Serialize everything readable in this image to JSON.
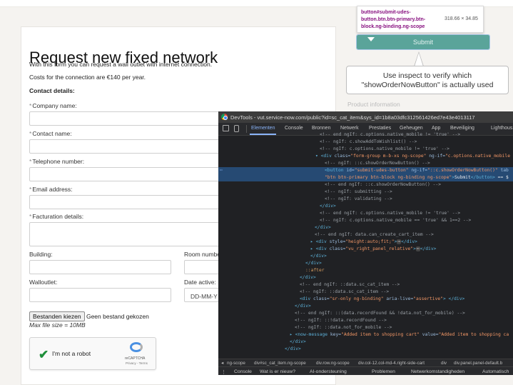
{
  "form": {
    "title": "Request new fixed network",
    "intro": "With this form you can request a wall outlet with internet connection.",
    "costs": "Costs for the connection are €140 per year.",
    "section": "Contact details:",
    "required_mark": "*",
    "fields": {
      "company": "Company name:",
      "contact": "Contact name:",
      "telephone": "Telephone number:",
      "email": "Email address:",
      "facturation": "Facturation details:",
      "building": "Building:",
      "room": "Room numbe",
      "walloutlet": "Walloutlet:",
      "date_active": "Date active:"
    },
    "date_placeholder": "DD-MM-Y",
    "file_button": "Bestanden kiezen",
    "file_status": "Geen bestand gekozen",
    "max_file_size": "Max file size = 10MB",
    "captcha": {
      "label": "I'm not a robot",
      "brand": "reCAPTCHA",
      "terms": "Privacy - Terms"
    }
  },
  "right_panel": {
    "submit_label": "Submit",
    "inspect_tooltip": {
      "selector": "button#submit-udes-button.btn.btn-primary.btn-block.ng-binding.ng-scope",
      "size": "318.66 × 34.85"
    },
    "callout": "Use inspect to verify which \"showOrderNowButton\" is actually used",
    "behind_text": "Product information"
  },
  "devtools": {
    "title": "DevTools - vut.service-now.com/public?id=sc_cat_item&sys_id=1b8a03dfc312561426ed7e43e4013117",
    "tabs": [
      "Elementen",
      "Console",
      "Bronnen",
      "Netwerk",
      "Prestaties",
      "Geheugen",
      "App",
      "Beveiliging",
      "Lighthous"
    ],
    "active_tab": "Elementen",
    "code": {
      "l0": "<!-- end ngIf: c.options.native_mobile != 'true' -->",
      "l1": "<!-- ngIf: c.showAddToWishlist() -->",
      "l2": "<!-- ngIf: c.options.native_mobile != 'true' -->",
      "l3_tag": "<div ",
      "l3_attr1": "class=",
      "l3_val1": "\"form-group m-b-xs ng-scope\"",
      "l3_attr2": " ng-if=",
      "l3_val2": "\"c.options.native_mobile",
      "l4": "<!-- ngIf: ::c.showOrderNowButton() -->",
      "l5_tag": "<button ",
      "l5_attr1": "id=",
      "l5_val1": "\"submit-udes-button\"",
      "l5_attr2": " ng-if=",
      "l5_val2": "\"::c.showOrderNowButton()\"",
      "l5_rest": " tab",
      "l6_val": "\"btn btn-primary btn-block ng-binding ng-scope\"",
      "l6_text": "Submit",
      "l6_close": "</button>",
      "l6_eq": " == $",
      "l7": "<!-- end ngIf: ::c.showOrderNowButton() -->",
      "l8": "<!-- ngIf: submitting -->",
      "l9": "<!-- ngIf: validating -->",
      "l10": "</div>",
      "l11": "<!-- end ngIf: c.options.native_mobile != 'true' -->",
      "l12": "<!-- ngIf: c.options.native_mobile == 'true' && 1==2 -->",
      "l13": "</div>",
      "l14": "<!-- end ngIf: data.can_create_cart_item -->",
      "l15_tag": "<div ",
      "l15_attr": "style=",
      "l15_val": "\"height:auto;fit;\"",
      "l15_end": "</div>",
      "l16_tag": "<div ",
      "l16_attr": "class=",
      "l16_val": "\"vu_right_panel_relative\"",
      "l16_end": "</div>",
      "l17": "</div>",
      "l18": "</div>",
      "l19": "::after",
      "l20": "</div>",
      "l21": "<!-- end ngIf: ::data.sc_cat_item -->",
      "l22": "<!-- ngIf: ::data.sc_cat_item -->",
      "l23_tag": "<div ",
      "l23_attr1": "class=",
      "l23_val1": "\"sr-only ng-binding\"",
      "l23_attr2": " aria-live=",
      "l23_val2": "\"assertive\"",
      "l23_end": "</div>",
      "l24": "</div>",
      "l25": "<!-- end ngIf: ::(data.recordFound && !data.not_for_mobile) -->",
      "l26": "<!-- ngIf: ::!data.recordFound -->",
      "l27": "<!-- ngIf: ::data.not_for_mobile -->",
      "l28_tag": "<now-message ",
      "l28_attr1": "key=",
      "l28_val1": "\"Added item to shopping cart\"",
      "l28_attr2": " value=",
      "l28_val2": "\"Added item to shopping ca",
      "l29": "</div>",
      "l30": "</div>",
      "ellipsis": "⋯",
      "dots": "⋯"
    },
    "breadcrumbs": [
      "ng-scope",
      "div#sc_cat_item.ng-scope",
      "div.row.ng-scope",
      "div.col-12.col-md-4.right-side-cart",
      "div",
      "div.panel.panel-default.b"
    ],
    "drawer_tabs": [
      "Console",
      "Wat is er nieuw?",
      "AI-ondersteuning",
      "Problemen",
      "Netwerkomstandigheden",
      "Automatisch"
    ]
  }
}
